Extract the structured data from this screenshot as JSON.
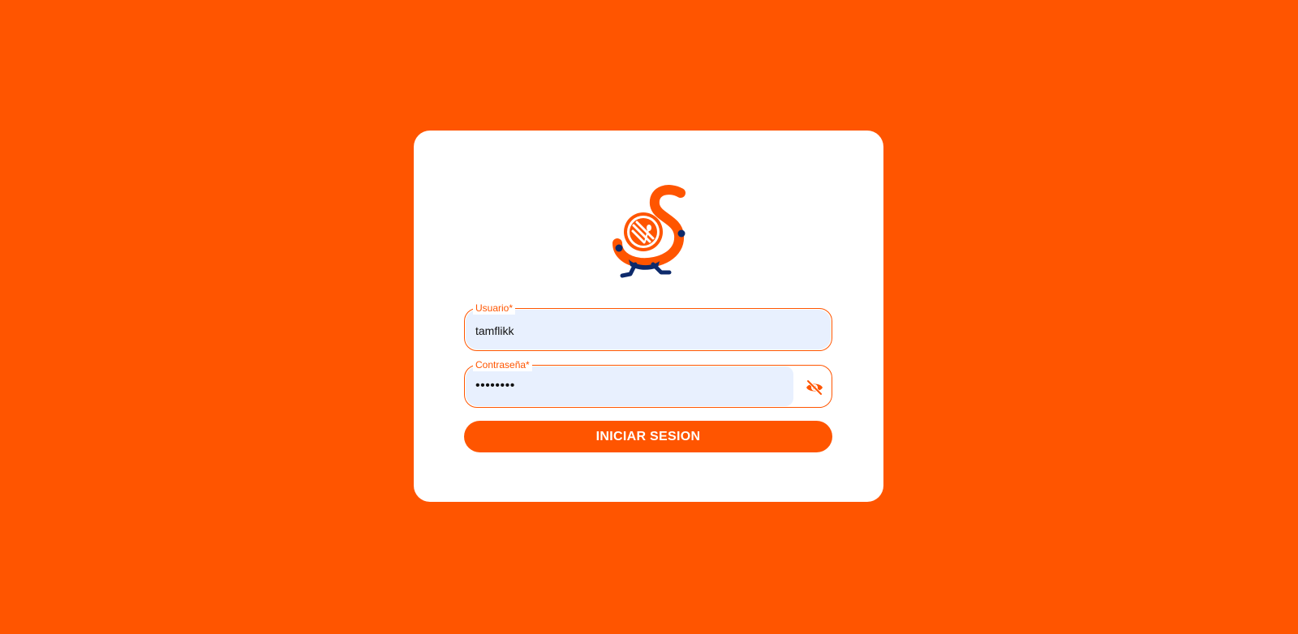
{
  "colors": {
    "background": "#FF5500",
    "accent": "#FF5500",
    "card": "#FFFFFF",
    "input_fill": "#E8F0FE",
    "logo_navy": "#0D2A6B"
  },
  "logo": {
    "icon": "mascot-logo"
  },
  "form": {
    "username": {
      "label": "Usuario*",
      "value": "tamflikk"
    },
    "password": {
      "label": "Contraseña*",
      "value": "••••••••",
      "toggle_icon": "eye-off-icon"
    },
    "submit_label": "INICIAR SESION"
  }
}
